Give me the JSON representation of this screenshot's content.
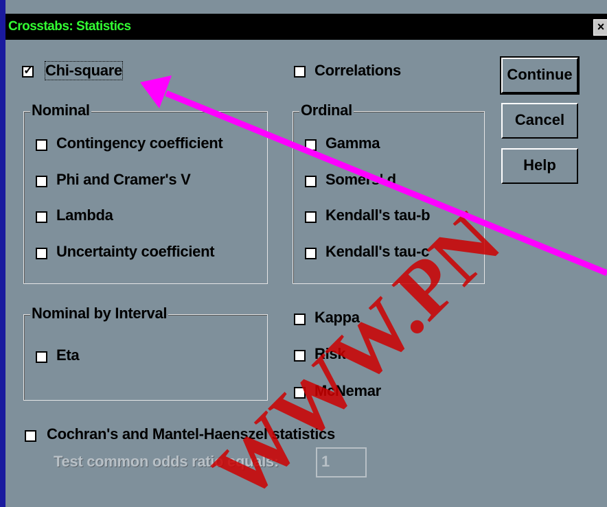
{
  "window": {
    "title": "Crosstabs: Statistics",
    "close_label": "×"
  },
  "checks": {
    "chi_square": "Chi-square",
    "correlations": "Correlations",
    "kappa": "Kappa",
    "risk": "Risk",
    "mcnemar": "McNemar",
    "cochran": "Cochran's and Mantel-Haenszel statistics"
  },
  "nominal": {
    "legend": "Nominal",
    "items": [
      "Contingency coefficient",
      "Phi and Cramer's V",
      "Lambda",
      "Uncertainty coefficient"
    ]
  },
  "ordinal": {
    "legend": "Ordinal",
    "items": [
      "Gamma",
      "Somers' d",
      "Kendall's tau-b",
      "Kendall's tau-c"
    ]
  },
  "nominal_by_interval": {
    "legend": "Nominal by Interval",
    "items": [
      "Eta"
    ]
  },
  "buttons": {
    "continue": "Continue",
    "cancel": "Cancel",
    "help": "Help"
  },
  "odds": {
    "label": "Test common odds ratio equals:",
    "value": "1"
  },
  "watermark": "WWW.PN",
  "colors": {
    "title_text": "#33ff33",
    "arrow": "#ff00ff",
    "watermark": "#cc0000"
  }
}
